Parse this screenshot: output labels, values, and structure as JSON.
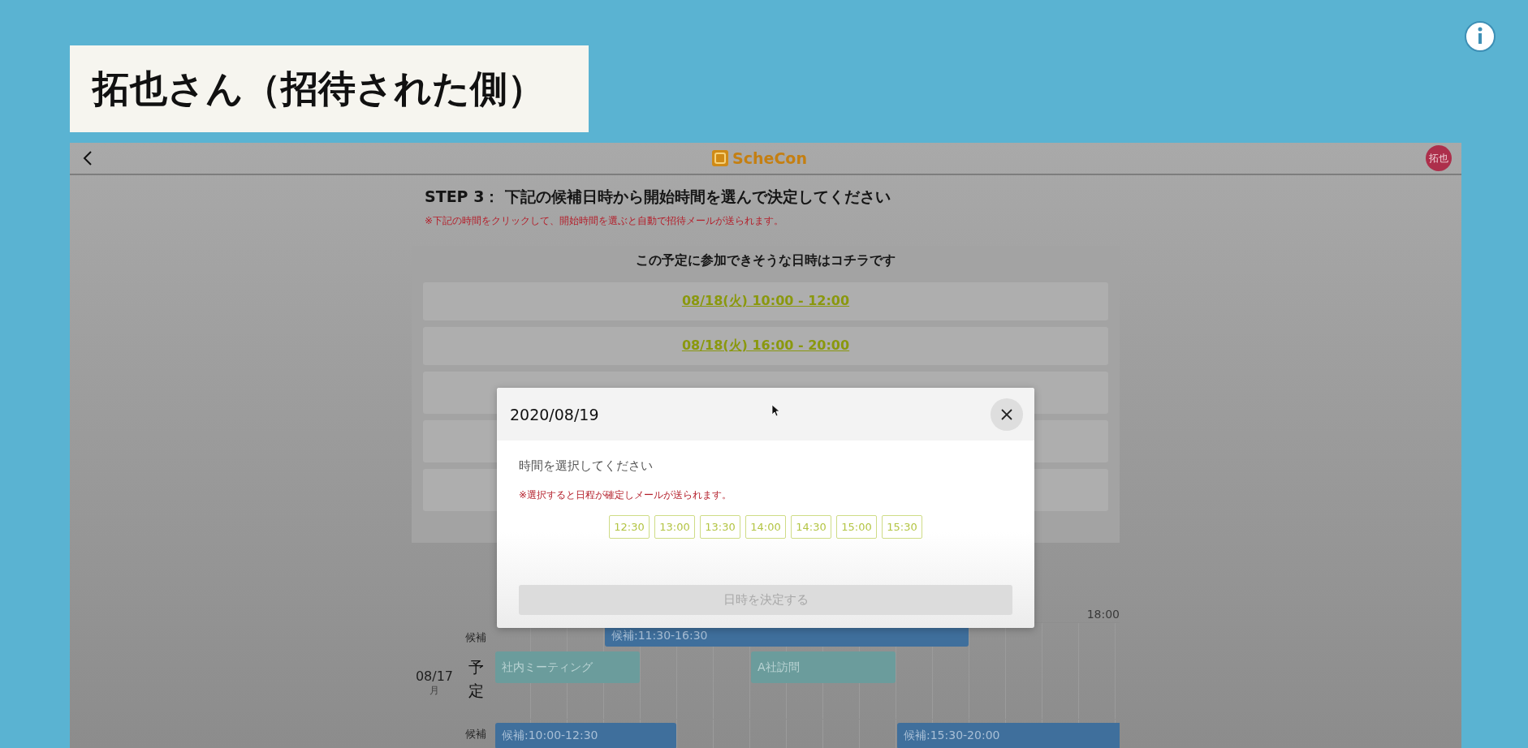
{
  "caption": "拓也さん（招待された側）",
  "header": {
    "logo": "ScheCon",
    "avatar": "拓也"
  },
  "step": {
    "title": "STEP 3： 下記の候補日時から開始時間を選んで決定してください",
    "note": "※下記の時間をクリックして、開始時間を選ぶと自動で招待メールが送られます。"
  },
  "candidates": {
    "heading": "この予定に参加できそうな日時はコチラです",
    "items": [
      "08/18(火) 10:00 - 12:00",
      "08/18(火) 16:00 - 20:00"
    ]
  },
  "timeline": {
    "tick": "18:00",
    "days": [
      {
        "date": "08/17",
        "weekday": "月",
        "candidate_label": "候補",
        "candidates": [
          "候補:11:30-16:30"
        ],
        "plan_label": "予定",
        "events": [
          "社内ミーティング",
          "A社訪問"
        ]
      },
      {
        "candidate_label": "候補",
        "candidates": [
          "候補:10:00-12:30",
          "候補:15:30-20:00"
        ]
      }
    ]
  },
  "modal": {
    "title": "2020/08/19",
    "prompt": "時間を選択してください",
    "note": "※選択すると日程が確定しメールが送られます。",
    "times": [
      "12:30",
      "13:00",
      "13:30",
      "14:00",
      "14:30",
      "15:00",
      "15:30"
    ],
    "confirm": {
      "label": "日時を決定する",
      "disabled": true
    }
  }
}
